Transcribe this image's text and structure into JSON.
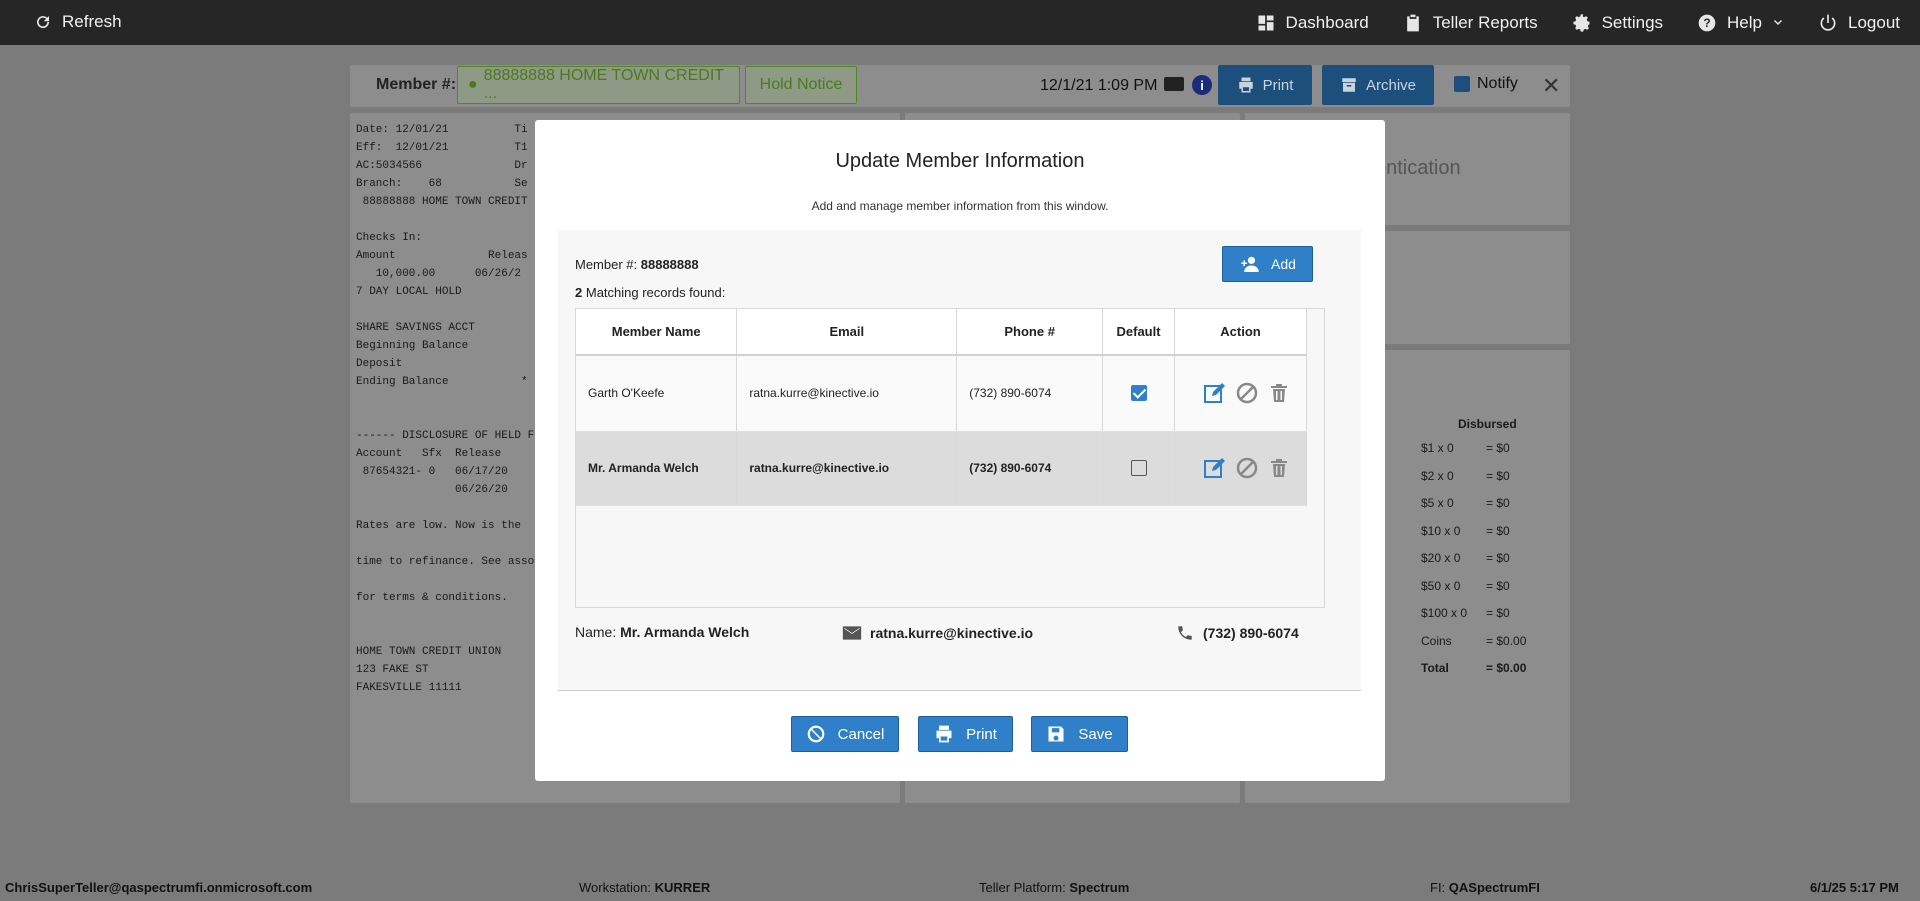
{
  "topbar": {
    "refresh_label": "Refresh",
    "nav": {
      "dashboard": "Dashboard",
      "teller_reports": "Teller Reports",
      "settings": "Settings",
      "help": "Help",
      "logout": "Logout"
    }
  },
  "header": {
    "member_label": "Member #:",
    "member_button": "88888888 HOME TOWN CREDIT ...",
    "hold_notice": "Hold Notice",
    "datetime": "12/1/21 1:09 PM",
    "info_icon_text": "i",
    "print_label": "Print",
    "archive_label": "Archive",
    "notify_label": "Notify",
    "notify_checked": true,
    "close_symbol": "✕"
  },
  "receipt": {
    "lines": [
      "Date: 12/01/21          Ti",
      "Eff:  12/01/21          T1",
      "AC:5034566              Dr",
      "Branch:    68           Se",
      " 88888888 HOME TOWN CREDIT",
      "",
      "Checks In:",
      "Amount              Releas",
      "   10,000.00      06/26/2",
      "7 DAY LOCAL HOLD",
      "",
      "SHARE SAVINGS ACCT",
      "Beginning Balance",
      "Deposit",
      "Ending Balance           *",
      "",
      "",
      "------ DISCLOSURE OF HELD F",
      "Account   Sfx  Release",
      " 87654321- 0   06/17/20",
      "               06/26/20",
      "",
      "Rates are low. Now is the",
      "",
      "time to refinance. See asso",
      "",
      "for terms & conditions.",
      "",
      "",
      "HOME TOWN CREDIT UNION",
      "123 FAKE ST",
      "FAKESVILLE 11111"
    ]
  },
  "auth_panel": {
    "text": "entication"
  },
  "disbursed": {
    "header": "Disbursed",
    "rows": [
      {
        "label": "$1 x 0",
        "value": "= $0"
      },
      {
        "label": "$2 x 0",
        "value": "= $0"
      },
      {
        "label": "$5 x 0",
        "value": "= $0"
      },
      {
        "label": "$10 x 0",
        "value": "= $0"
      },
      {
        "label": "$20 x 0",
        "value": "= $0"
      },
      {
        "label": "$50 x 0",
        "value": "= $0"
      },
      {
        "label": "$100 x 0",
        "value": "= $0"
      },
      {
        "label": "Coins",
        "value": "= $0.00"
      },
      {
        "label": "Total",
        "value": "= $0.00"
      }
    ]
  },
  "modal": {
    "title": "Update Member Information",
    "subtitle": "Add and manage member information from this window.",
    "member_label": "Member #:",
    "member_number": "88888888",
    "match_count": "2",
    "match_text": "Matching records found:",
    "add_label": "Add",
    "table": {
      "headers": [
        "Member Name",
        "Email",
        "Phone #",
        "Default",
        "Action"
      ],
      "rows": [
        {
          "name": "Garth O'Keefe",
          "email": "ratna.kurre@kinective.io",
          "phone": "(732) 890-6074",
          "default": true
        },
        {
          "name": "Mr. Armanda Welch",
          "email": "ratna.kurre@kinective.io",
          "phone": "(732) 890-6074",
          "default": false
        }
      ]
    },
    "summary": {
      "name_label": "Name:",
      "name": "Mr. Armanda Welch",
      "email": "ratna.kurre@kinective.io",
      "phone": "(732) 890-6074"
    },
    "buttons": {
      "cancel": "Cancel",
      "print": "Print",
      "save": "Save"
    }
  },
  "statusbar": {
    "user": "ChrisSuperTeller@qaspectrumfi.onmicrosoft.com",
    "workstation_label": "Workstation:",
    "workstation": "KURRER",
    "platform_label": "Teller Platform:",
    "platform": "Spectrum",
    "fi_label": "FI:",
    "fi": "QASpectrumFI",
    "datetime": "6/1/25 5:17 PM"
  },
  "colors": {
    "accent": "#2f80c8",
    "topbar": "#262626",
    "overlay": "#7b7b7b",
    "success": "#4f8a20"
  }
}
